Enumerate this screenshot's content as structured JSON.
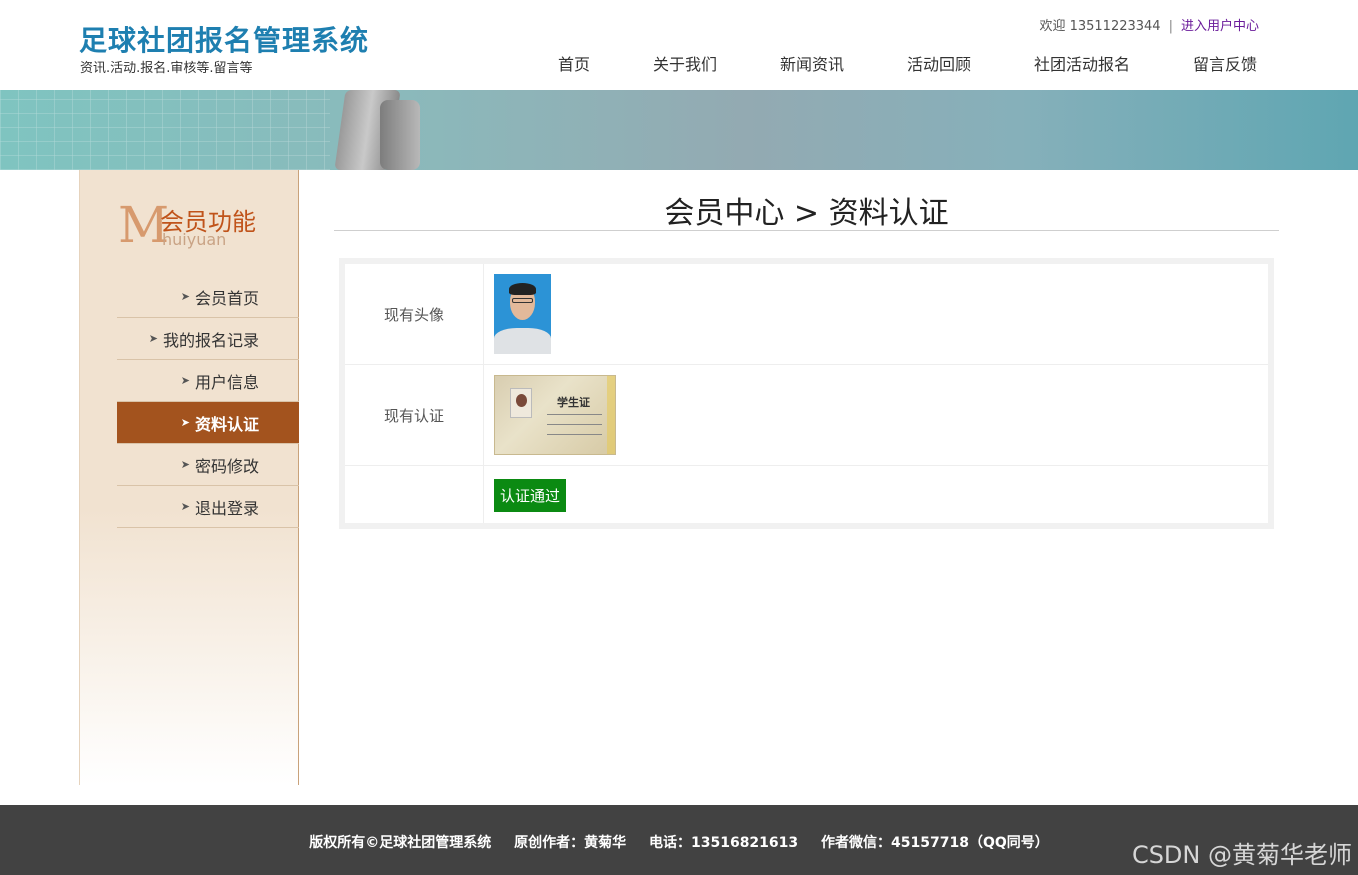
{
  "header": {
    "title": "足球社团报名管理系统",
    "subtitle": "资讯.活动.报名.审核等.留言等",
    "welcome_prefix": "欢迎 13511223344",
    "separator": "|",
    "user_center_link": "进入用户中心"
  },
  "nav": {
    "items": [
      {
        "label": "首页"
      },
      {
        "label": "关于我们"
      },
      {
        "label": "新闻资讯"
      },
      {
        "label": "活动回顾"
      },
      {
        "label": "社团活动报名"
      },
      {
        "label": "留言反馈"
      }
    ]
  },
  "sidebar": {
    "title_letter": "M",
    "title_cn": "会员功能",
    "title_en": "huiyuan",
    "arrow": "➤",
    "items": [
      {
        "label": "会员首页",
        "active": false
      },
      {
        "label": "我的报名记录",
        "active": false
      },
      {
        "label": "用户信息",
        "active": false
      },
      {
        "label": "资料认证",
        "active": true
      },
      {
        "label": "密码修改",
        "active": false
      },
      {
        "label": "退出登录",
        "active": false
      }
    ]
  },
  "main": {
    "page_title": "会员中心 > 资料认证",
    "rows": [
      {
        "label": "现有头像"
      },
      {
        "label": "现有认证"
      },
      {
        "label": ""
      }
    ],
    "card_title": "学生证",
    "status_button": "认证通过"
  },
  "footer": {
    "copyright": "版权所有©足球社团管理系统",
    "author": "原创作者：黄菊华",
    "phone": "电话：13516821613",
    "wechat": "作者微信：45157718（QQ同号）"
  },
  "watermark": "CSDN @黄菊华老师",
  "colors": {
    "brand_blue": "#1e7fb0",
    "sidebar_active": "#a3531e",
    "status_green": "#0b8a12",
    "footer_bg": "#424242"
  }
}
